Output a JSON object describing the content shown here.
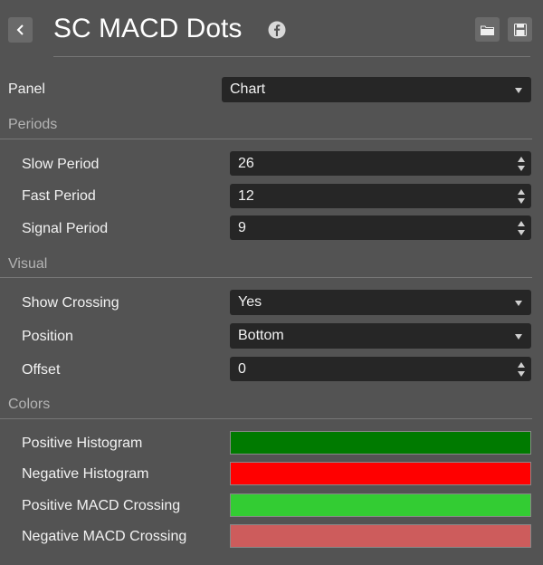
{
  "header": {
    "title": "SC MACD Dots",
    "icons": [
      "chevron-left-icon",
      "facebook-icon",
      "folder-icon",
      "save-icon"
    ]
  },
  "panel": {
    "label": "Panel",
    "value": "Chart"
  },
  "periods": {
    "section_title": "Periods",
    "slow": {
      "label": "Slow Period",
      "value": "26"
    },
    "fast": {
      "label": "Fast Period",
      "value": "12"
    },
    "signal": {
      "label": "Signal Period",
      "value": "9"
    }
  },
  "visual": {
    "section_title": "Visual",
    "show_crossing": {
      "label": "Show Crossing",
      "value": "Yes"
    },
    "position": {
      "label": "Position",
      "value": "Bottom"
    },
    "offset": {
      "label": "Offset",
      "value": "0"
    }
  },
  "colors": {
    "section_title": "Colors",
    "positive_histogram": {
      "label": "Positive Histogram",
      "color": "#007a00"
    },
    "negative_histogram": {
      "label": "Negative Histogram",
      "color": "#ff0000"
    },
    "positive_macd_crossing": {
      "label": "Positive MACD Crossing",
      "color": "#33cc33"
    },
    "negative_macd_crossing": {
      "label": "Negative MACD Crossing",
      "color": "#cd5c5c"
    }
  }
}
